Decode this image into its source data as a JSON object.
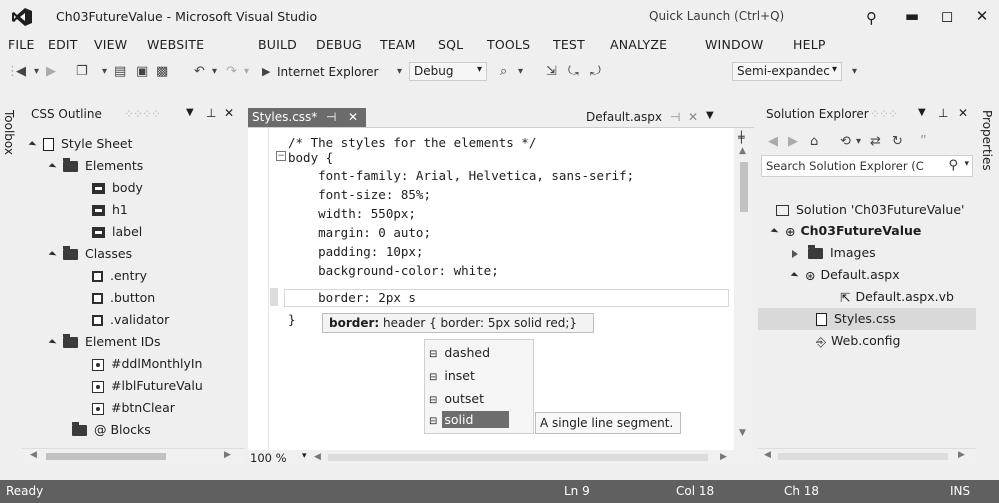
{
  "window": {
    "title": "Ch03FutureValue - Microsoft Visual Studio",
    "quick_launch": "Quick Launch (Ctrl+Q)"
  },
  "menu": [
    "FILE",
    "EDIT",
    "VIEW",
    "WEBSITE",
    "BUILD",
    "DEBUG",
    "TEAM",
    "SQL",
    "TOOLS",
    "TEST",
    "ANALYZE",
    "WINDOW",
    "HELP"
  ],
  "toolbar": {
    "browser": "Internet Explorer",
    "config": "Debug",
    "semi": "Semi-expandec"
  },
  "toolbox_label": "Toolbox",
  "properties_label": "Properties",
  "css_outline": {
    "title": "CSS Outline",
    "items": [
      {
        "label": "Style Sheet",
        "icon": "stylesheet-icon"
      },
      {
        "label": "Elements",
        "icon": "folder-icon"
      },
      {
        "label": "body",
        "icon": "element-icon"
      },
      {
        "label": "h1",
        "icon": "element-icon"
      },
      {
        "label": "label",
        "icon": "element-icon"
      },
      {
        "label": "Classes",
        "icon": "folder-icon"
      },
      {
        "label": ".entry",
        "icon": "class-icon"
      },
      {
        "label": ".button",
        "icon": "class-icon"
      },
      {
        "label": ".validator",
        "icon": "class-icon"
      },
      {
        "label": "Element IDs",
        "icon": "folder-icon"
      },
      {
        "label": "#ddlMonthlyIn",
        "icon": "id-icon"
      },
      {
        "label": "#lblFutureValu",
        "icon": "id-icon"
      },
      {
        "label": "#btnClear",
        "icon": "id-icon"
      },
      {
        "label": "@ Blocks",
        "icon": "folder-icon"
      }
    ]
  },
  "editor": {
    "tab_active": "Styles.css*",
    "tab_other": "Default.aspx",
    "lines": [
      "/* The styles for the elements */",
      "body {",
      "    font-family: Arial, Helvetica, sans-serif;",
      "    font-size: 85%;",
      "    width: 550px;",
      "    margin: 0 auto;",
      "    padding: 10px;",
      "    background-color: white;",
      "    border: 2px s",
      "}"
    ],
    "tooltip_bold": "border:",
    "tooltip_rest": " header { border: 5px solid red;}",
    "completions": [
      "dashed",
      "inset",
      "outset",
      "solid"
    ],
    "selected_completion": "solid",
    "completion_desc": "A single line segment.",
    "zoom": "100 %"
  },
  "solution_explorer": {
    "title": "Solution Explorer",
    "search_placeholder": "Search Solution Explorer (C",
    "items": [
      {
        "label": "Solution 'Ch03FutureValue'",
        "icon": "solution-icon"
      },
      {
        "label": "Ch03FutureValue",
        "icon": "globe-icon"
      },
      {
        "label": "Images",
        "icon": "folder-icon"
      },
      {
        "label": "Default.aspx",
        "icon": "aspx-icon"
      },
      {
        "label": "Default.aspx.vb",
        "icon": "vb-file-icon"
      },
      {
        "label": "Styles.css",
        "icon": "css-file-icon"
      },
      {
        "label": "Web.config",
        "icon": "config-icon"
      }
    ]
  },
  "status": {
    "state": "Ready",
    "ln": "Ln 9",
    "col": "Col 18",
    "ch": "Ch 18",
    "mode": "INS"
  },
  "colors": {
    "status_bg": "#606060",
    "selection": "#6d6d6d",
    "chrome": "#efefef"
  }
}
